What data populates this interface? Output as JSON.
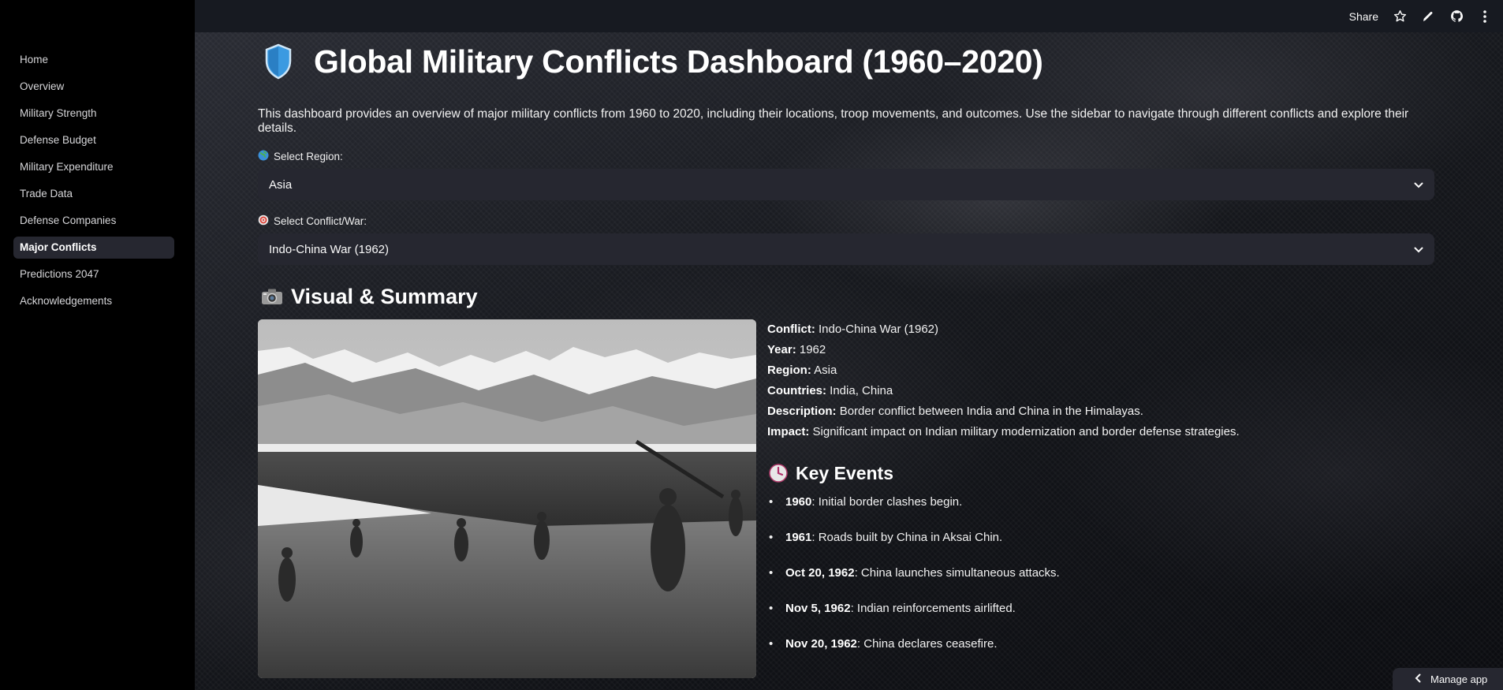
{
  "sidebar": {
    "items": [
      {
        "label": "Home"
      },
      {
        "label": "Overview"
      },
      {
        "label": "Military Strength"
      },
      {
        "label": "Defense Budget"
      },
      {
        "label": "Military Expenditure"
      },
      {
        "label": "Trade Data"
      },
      {
        "label": "Defense Companies"
      },
      {
        "label": "Major Conflicts",
        "active": true
      },
      {
        "label": "Predictions 2047"
      },
      {
        "label": "Acknowledgements"
      }
    ]
  },
  "topbar": {
    "share_label": "Share",
    "icons": [
      "star-icon",
      "pencil-icon",
      "github-icon",
      "more-vertical-icon"
    ]
  },
  "page": {
    "title": "Global Military Conflicts Dashboard (1960–2020)",
    "title_icon": "shield-icon",
    "intro": "This dashboard provides an overview of major military conflicts from 1960 to 2020, including their locations, troop movements, and outcomes. Use the sidebar to navigate through different conflicts and explore their details."
  },
  "filters": {
    "region": {
      "label": "Select Region:",
      "icon": "globe-icon",
      "value": "Asia"
    },
    "conflict": {
      "label": "Select Conflict/War:",
      "icon": "target-icon",
      "value": "Indo-China War (1962)"
    }
  },
  "visual_summary": {
    "heading": "Visual & Summary",
    "heading_icon": "camera-icon",
    "photo_subject": "soldiers-on-mountain-lakeshore-photo",
    "details": {
      "conflict_label": "Conflict:",
      "conflict": "Indo-China War (1962)",
      "year_label": "Year:",
      "year": "1962",
      "region_label": "Region:",
      "region": "Asia",
      "countries_label": "Countries:",
      "countries": "India, China",
      "description_label": "Description:",
      "description": "Border conflict between India and China in the Himalayas.",
      "impact_label": "Impact:",
      "impact": "Significant impact on Indian military modernization and border defense strategies."
    }
  },
  "key_events": {
    "heading": "Key Events",
    "heading_icon": "clock-icon",
    "items": [
      {
        "date": "1960",
        "text": ": Initial border clashes begin."
      },
      {
        "date": "1961",
        "text": ": Roads built by China in Aksai Chin."
      },
      {
        "date": "Oct 20, 1962",
        "text": ": China launches simultaneous attacks."
      },
      {
        "date": "Nov 5, 1962",
        "text": ": Indian reinforcements airlifted."
      },
      {
        "date": "Nov 20, 1962",
        "text": ": China declares ceasefire."
      }
    ]
  },
  "footer": {
    "manage_label": "Manage app"
  },
  "colors": {
    "sidebar_bg": "#000000",
    "topbar_bg": "#171a21",
    "select_bg": "#262730",
    "active_item_bg": "#262730",
    "shield_blue": "#3b9ae1"
  }
}
